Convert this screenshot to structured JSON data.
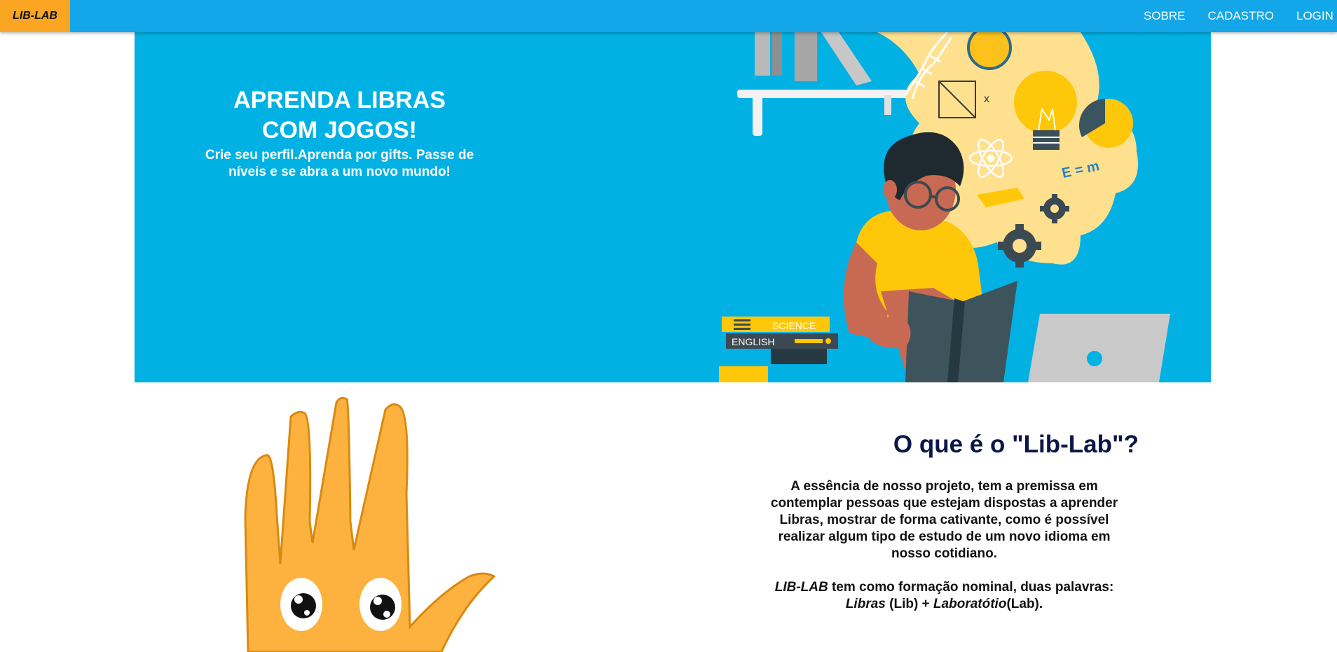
{
  "navbar": {
    "brand": "LIB-LAB",
    "links": [
      "SOBRE",
      "CADASTRO",
      "LOGIN"
    ],
    "colors": {
      "bar": "#13a6e8",
      "brand": "#faa623"
    }
  },
  "hero": {
    "title": "APRENDA LIBRAS COM JOGOS!",
    "subtitle": "Crie seu perfil.Aprenda por gifts. Passe de níveis e se abra a um novo mundo!",
    "illustration": {
      "book_labels": [
        "SCIENCE",
        "ENGLISH"
      ],
      "formula": "E = m...",
      "icons": [
        "dna-icon",
        "lightbulb-icon",
        "gear-icon",
        "atom-icon",
        "pie-chart-icon",
        "laptop-icon",
        "book-icon"
      ]
    },
    "background": "#02b1e3"
  },
  "about": {
    "title": "O que é o \"Lib-Lab\"?",
    "paragraph1": "A essência de nosso projeto, tem a premissa em contemplar pessoas que estejam dispostas a aprender Libras, mostrar de forma cativante, como é possível realizar algum tipo de estudo de um novo idioma em nosso cotidiano.",
    "p2_brand": "LIB-LAB",
    "p2_text": " tem como formação nominal, duas palavras:",
    "p2_word1": "Libras",
    "p2_abbr1": " (Lib) + ",
    "p2_word2": "Laboratótio",
    "p2_abbr2": "(Lab)."
  },
  "mascot": {
    "name": "hand-mascot-icon",
    "color": "#fdb13e"
  }
}
